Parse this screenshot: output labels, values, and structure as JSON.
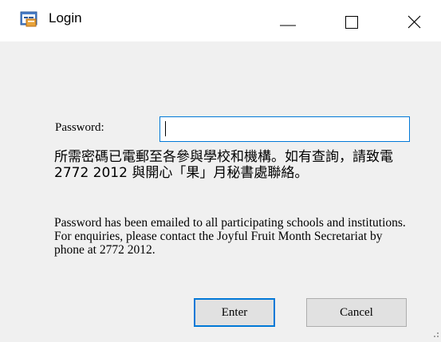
{
  "window": {
    "title": "Login",
    "icon": "form-app-icon",
    "controls": {
      "minimize": "minimize-icon",
      "maximize": "maximize-icon",
      "close": "close-icon"
    }
  },
  "form": {
    "password_label": "Password:",
    "password_value": "",
    "notice_zh": "所需密碼已電郵至各參與學校和機構。如有查詢，請致電 2772 2012 與開心「果」月秘書處聯絡。",
    "notice_en": "Password has been emailed to all participating schools and institutions. For enquiries, please contact the Joyful Fruit Month Secretariat by phone at 2772 2012.",
    "enter_label": "Enter",
    "cancel_label": "Cancel"
  },
  "colors": {
    "accent": "#0078d7",
    "background": "#f0f0f0",
    "button": "#e1e1e1"
  }
}
